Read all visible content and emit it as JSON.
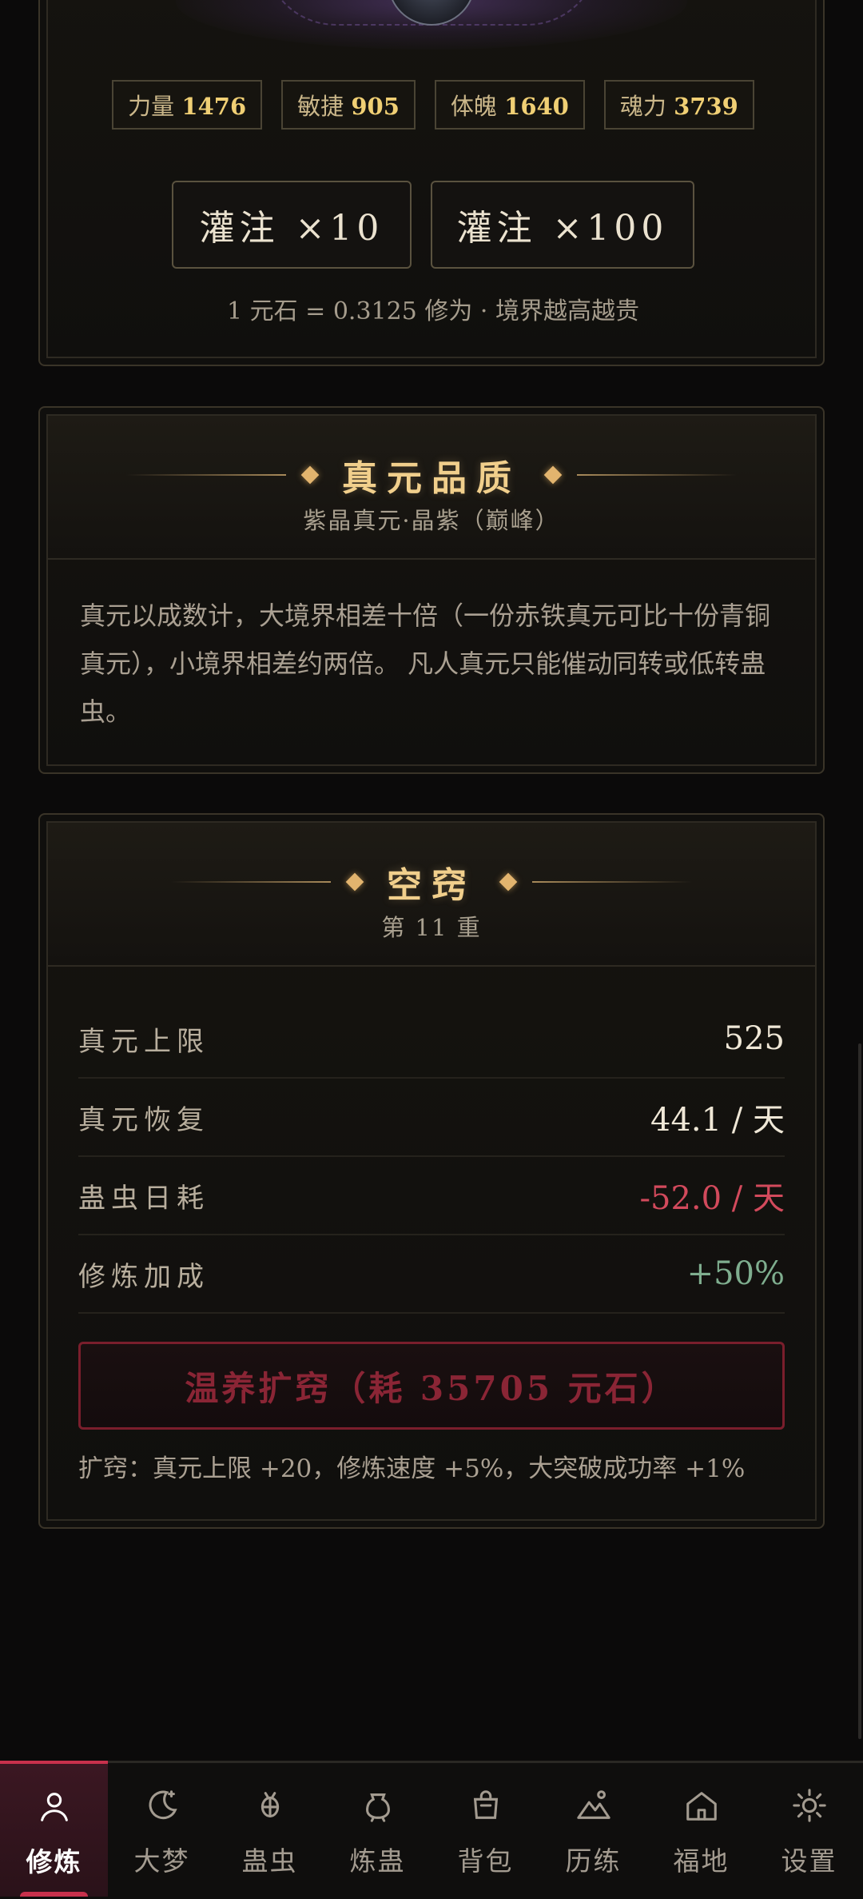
{
  "stats": [
    {
      "name": "力量",
      "value": "1476"
    },
    {
      "name": "敏捷",
      "value": "905"
    },
    {
      "name": "体魄",
      "value": "1640"
    },
    {
      "name": "魂力",
      "value": "3739"
    }
  ],
  "infuse": {
    "btn10": "灌注 ×10",
    "btn100": "灌注 ×100",
    "rate_note": "1 元石 = 0.3125 修为 · 境界越高越贵"
  },
  "quality": {
    "title": "真元品质",
    "subtitle": "紫晶真元·晶紫（巅峰）",
    "description": "真元以成数计，大境界相差十倍（一份赤铁真元可比十份青铜真元），小境界相差约两倍。 凡人真元只能催动同转或低转蛊虫。"
  },
  "aperture": {
    "title": "空窍",
    "subtitle": "第 11 重",
    "rows": [
      {
        "label": "真元上限",
        "value": "525"
      },
      {
        "label": "真元恢复",
        "value": "44.1 / 天"
      },
      {
        "label": "蛊虫日耗",
        "value": "-52.0 / 天"
      },
      {
        "label": "修炼加成",
        "value": "+50%"
      }
    ],
    "warm_button": "温养扩窍（耗 35705 元石）",
    "expand_note": "扩窍：真元上限 +20，修炼速度 +5%，大突破成功率 +1%"
  },
  "nav": {
    "items": [
      {
        "label": "修炼",
        "icon": "person-icon",
        "active": true
      },
      {
        "label": "大梦",
        "icon": "moon-icon",
        "active": false
      },
      {
        "label": "蛊虫",
        "icon": "bug-icon",
        "active": false
      },
      {
        "label": "炼蛊",
        "icon": "cauldron-icon",
        "active": false
      },
      {
        "label": "背包",
        "icon": "bag-icon",
        "active": false
      },
      {
        "label": "历练",
        "icon": "mountain-icon",
        "active": false
      },
      {
        "label": "福地",
        "icon": "home-icon",
        "active": false
      },
      {
        "label": "设置",
        "icon": "gear-icon",
        "active": false
      }
    ]
  },
  "colors": {
    "accent_gold": "#f1cf8c",
    "active_red": "#c8314c",
    "negative": "#d24a5c",
    "positive": "#7fae8f"
  }
}
